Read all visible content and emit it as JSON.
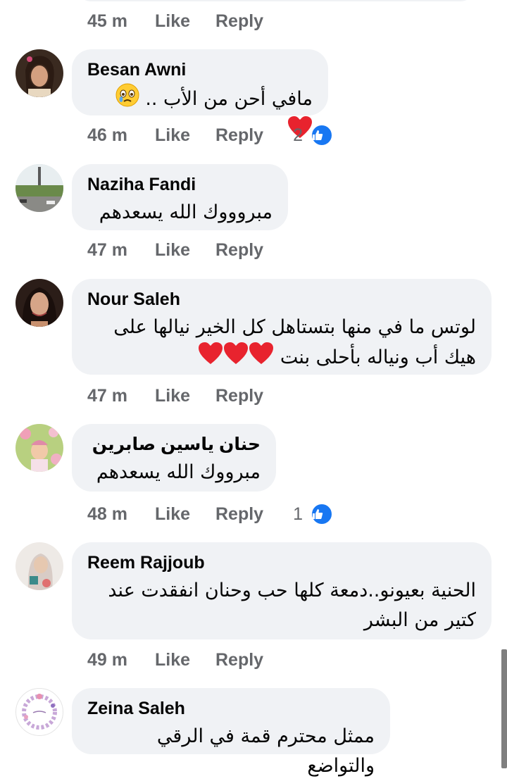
{
  "labels": {
    "like": "Like",
    "reply": "Reply"
  },
  "top_meta": {
    "time": "45 m"
  },
  "comments": [
    {
      "name": "Besan Awni",
      "text": "مافي أحن من الأب ..",
      "time": "46 m",
      "reactions": "2"
    },
    {
      "name": "Naziha Fandi",
      "text": "مبروووك الله يسعدهم",
      "time": "47 m"
    },
    {
      "name": "Nour Saleh",
      "text_line1": "لوتس ما في منها بتستاهل كل الخير نيالها على",
      "text_line2": "هيك أب ونياله بأحلى بنت",
      "time": "47 m"
    },
    {
      "name": "حنان ياسين صابرين",
      "text": "مبرووك الله يسعدهم",
      "time": "48 m",
      "reactions": "1"
    },
    {
      "name": "Reem Rajjoub",
      "text_line1": "الحنية بعيونو..دمعة كلها حب وحنان انفقدت عند",
      "text_line2": "كتير من البشر",
      "time": "49 m"
    },
    {
      "name": "Zeina Saleh",
      "text": "ممثل محترم قمة في الرقي والتواضع"
    }
  ],
  "colors": {
    "bubble": "#f0f2f5",
    "meta": "#65676b",
    "like_badge": "#1877f2",
    "heart": "#e8232e"
  },
  "icons": {
    "reaction": "like-thumb-icon",
    "emoji_heart": "red-heart-emoji",
    "emoji_tear": "crying-face-emoji"
  }
}
